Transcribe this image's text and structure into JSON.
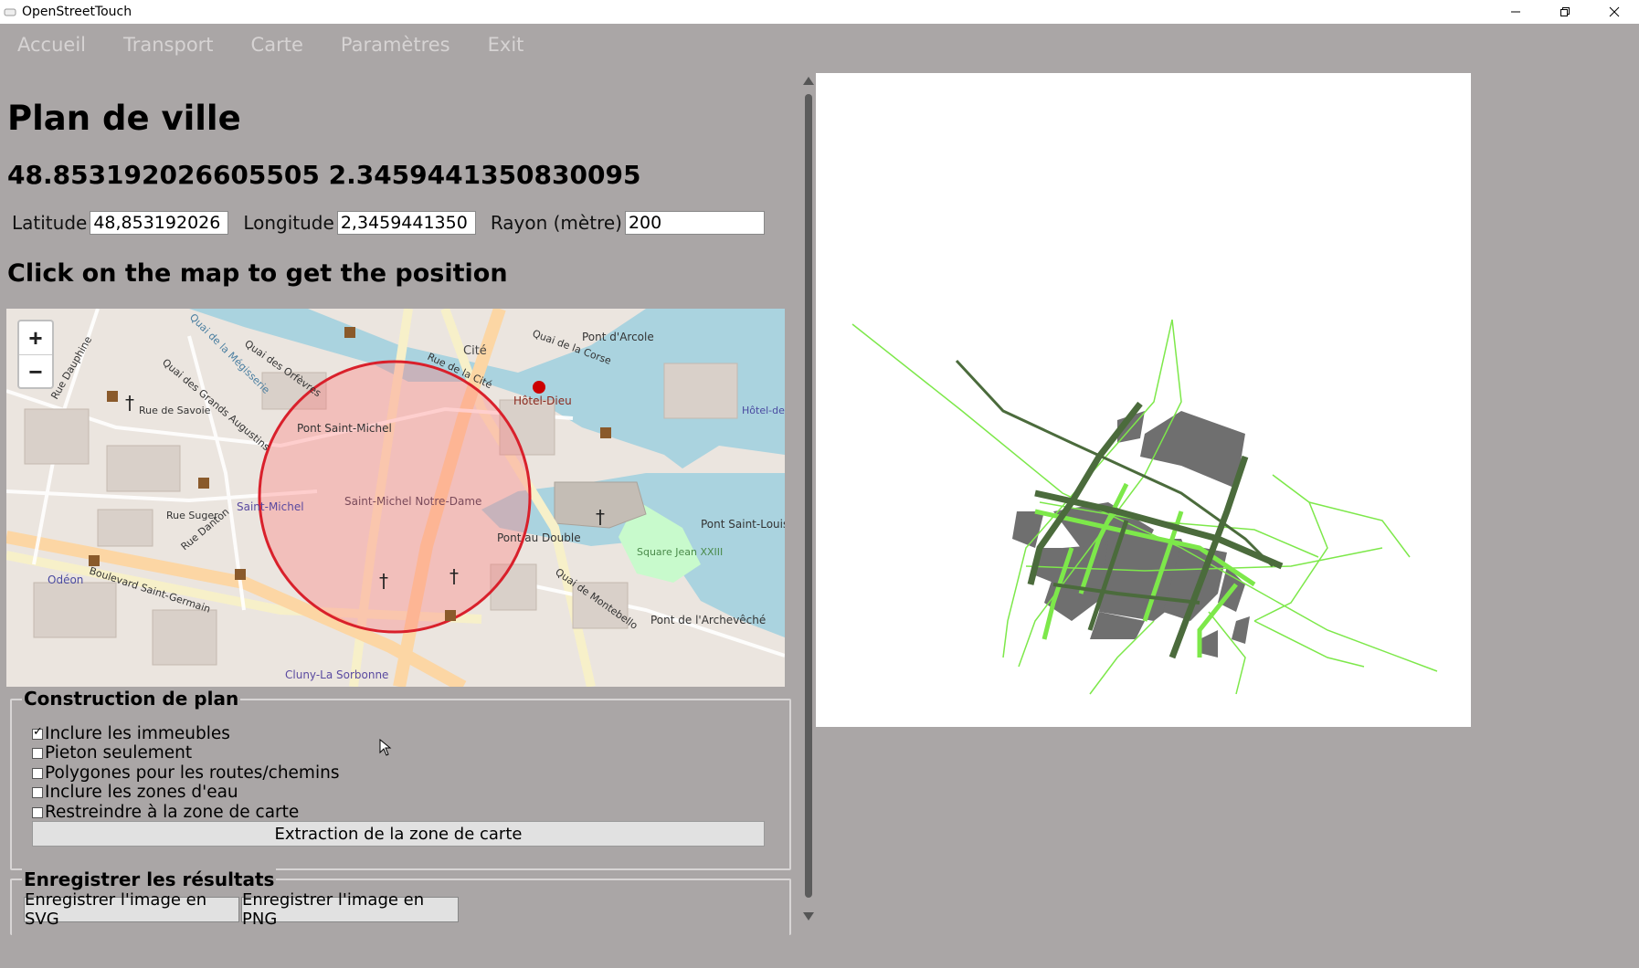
{
  "window": {
    "title": "OpenStreetTouch",
    "controls": {
      "minimize": "minimize-icon",
      "restore": "restore-icon",
      "close": "close-icon"
    }
  },
  "menu": {
    "items": [
      "Accueil",
      "Transport",
      "Carte",
      "Paramètres",
      "Exit"
    ]
  },
  "page": {
    "title": "Plan de ville",
    "coordinates": "48.853192026605505 2.3459441350830095",
    "click_hint": "Click on the map to get the position"
  },
  "fields": {
    "latitude_label": "Latitude",
    "latitude_value": "48,853192026",
    "longitude_label": "Longitude",
    "longitude_value": "2,3459441350",
    "radius_label": "Rayon (mètre)",
    "radius_value": "200"
  },
  "map": {
    "zoom_in": "+",
    "zoom_out": "−",
    "labels": [
      "Pont d'Arcole",
      "Hôtel-Dieu",
      "Cité",
      "Pont Saint-Michel",
      "Saint-Michel Notre-Dame",
      "Saint-Michel",
      "Odéon",
      "Pont au Double",
      "Pont Saint-Louis",
      "Square Jean XXIII",
      "Pont de l'Archevêché",
      "Quai de Montebello",
      "Boulevard Saint-Germain",
      "Rue Danton",
      "Rue Suger",
      "Rue de Savoie",
      "Cluny-La Sorbonne",
      "Hôtel-de-Ville",
      "Quai des Grands Augustins",
      "Quai des Orfèvres",
      "Rue de la Cité",
      "Quai de la Corse",
      "Rue Dauphine",
      "Quai de la Mégisserie"
    ],
    "colors": {
      "circle": "#d9202b",
      "water": "#aad3df",
      "park": "#c8facc",
      "roads": "#f8d9a0"
    }
  },
  "construction": {
    "legend": "Construction de plan",
    "options": [
      {
        "label": "Inclure les immeubles",
        "checked": true
      },
      {
        "label": "Pieton seulement",
        "checked": false
      },
      {
        "label": "Polygones pour les routes/chemins",
        "checked": false
      },
      {
        "label": "Inclure les zones d'eau",
        "checked": false
      },
      {
        "label": "Restreindre à la zone de carte",
        "checked": false
      }
    ],
    "extract_button": "Extraction de la zone de carte"
  },
  "results": {
    "legend": "Enregistrer les résultats",
    "svg_button": "Enregistrer l'image en SVG",
    "png_button": "Enregistrer l'image en PNG"
  },
  "preview": {
    "colors": {
      "light_green": "#7de84a",
      "dark_green": "#4b6b3c",
      "buildings": "#6f6f6f"
    }
  }
}
